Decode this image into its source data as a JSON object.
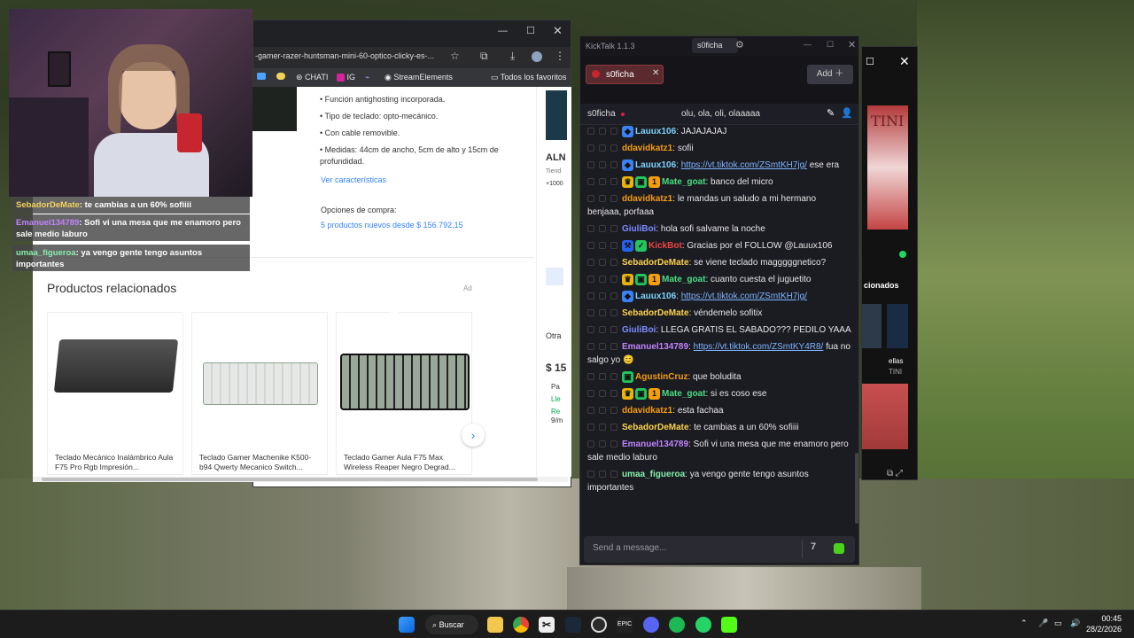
{
  "browser": {
    "url": "-gamer-razer-huntsman-mini-60-optico-clicky-es-...",
    "bookmarks": [
      "CHATI",
      "IG",
      "StreamElements",
      "Todos los favoritos"
    ],
    "features": [
      "Función antighosting incorporada.",
      "Tipo de teclado: opto-mecánico.",
      "Con cable removible.",
      "Medidas: 44cm de ancho, 5cm de alto y 15cm de profundidad."
    ],
    "ver_caracteristicas": "Ver características",
    "opciones_label": "Opciones de compra:",
    "opciones_link": "5 productos nuevos desde $ 156.792,15",
    "related_title": "Productos relacionados",
    "ad_label": "Ad",
    "products": [
      {
        "name": "Teclado Mecánico Inalámbrico Aula F75 Pro Rgb Impresión..."
      },
      {
        "name": "Teclado Gamer Machenike K500-b94 Qwerty Mecanico Switch..."
      },
      {
        "name": "Teclado Gamer Aula F75 Max Wireless Reaper Negro Degrad..."
      }
    ],
    "side_texts": [
      "ALN",
      "Tiend",
      "+1000",
      "Otra",
      "$ 15",
      "Pa",
      "Lle",
      "Re",
      "9/m"
    ]
  },
  "overlay": [
    {
      "user": "SebadorDeMate",
      "text": "te cambias a un 60% sofiiii",
      "color": "#f4d35e"
    },
    {
      "user": "Emanuel134789",
      "text": "Sofi vi una mesa que me enamoro pero sale medio laburo",
      "color": "#c084fc"
    },
    {
      "user": "umaa_figueroa",
      "text": "ya vengo gente tengo asuntos importantes",
      "color": "#86efac"
    }
  ],
  "kicktalk": {
    "app_title": "KickTalk 1.1.3",
    "channel_tab_title": "s0ficha",
    "tab_name": "s0ficha",
    "add_label": "Add",
    "header_channel": "s0ficha",
    "header_message": "olu, ola, oli, olaaaaa",
    "input_placeholder": "Send a message...",
    "messages": [
      {
        "user": "Lauux106",
        "color": "#7dd3fc",
        "badges": [
          "sub"
        ],
        "text": "JAJAJAJAJ",
        "link": ""
      },
      {
        "user": "ddavidkatz1",
        "color": "#f59e0b",
        "badges": [],
        "text": "sofii",
        "link": ""
      },
      {
        "user": "Lauux106",
        "color": "#7dd3fc",
        "badges": [
          "sub"
        ],
        "text": " ese era",
        "link": "https://vt.tiktok.com/ZSmtKH7jg/"
      },
      {
        "user": "Mate_goat",
        "color": "#4ade80",
        "badges": [
          "crown",
          "og",
          "one"
        ],
        "text": "banco del micro",
        "link": ""
      },
      {
        "user": "ddavidkatz1",
        "color": "#f59e0b",
        "badges": [],
        "text": "le mandas un saludo a mi hermano benjaaa, porfaaa",
        "link": ""
      },
      {
        "user": "GiuliBoi",
        "color": "#7c8cff",
        "badges": [],
        "text": "hola sofi salvame la noche",
        "link": ""
      },
      {
        "user": "KickBot",
        "color": "#ef4444",
        "badges": [
          "bot",
          "verified"
        ],
        "text": "Gracias por el FOLLOW @Lauux106",
        "link": ""
      },
      {
        "user": "SebadorDeMate",
        "color": "#fcd34d",
        "badges": [],
        "text": "se viene teclado magggggnetico?",
        "link": ""
      },
      {
        "user": "Mate_goat",
        "color": "#4ade80",
        "badges": [
          "crown",
          "og",
          "one"
        ],
        "text": "cuanto cuesta el juguetito",
        "link": ""
      },
      {
        "user": "Lauux106",
        "color": "#7dd3fc",
        "badges": [
          "sub"
        ],
        "text": "",
        "link": "https://vt.tiktok.com/ZSmtKH7jg/"
      },
      {
        "user": "SebadorDeMate",
        "color": "#fcd34d",
        "badges": [],
        "text": "véndemelo sofitix",
        "link": ""
      },
      {
        "user": "GiuliBoi",
        "color": "#7c8cff",
        "badges": [],
        "text": "LLEGA GRATIS EL SABADO??? PEDILO YAAA",
        "link": ""
      },
      {
        "user": "Emanuel134789",
        "color": "#c084fc",
        "badges": [],
        "text": " fua no salgo yo 😊",
        "link": "https://vt.tiktok.com/ZSmtKY4R8/"
      },
      {
        "user": "AgustinCruz",
        "color": "#f59e0b",
        "badges": [
          "og"
        ],
        "text": "que boludita",
        "link": ""
      },
      {
        "user": "Mate_goat",
        "color": "#4ade80",
        "badges": [
          "crown",
          "og",
          "one"
        ],
        "text": "si es coso ese",
        "link": ""
      },
      {
        "user": "ddavidkatz1",
        "color": "#f59e0b",
        "badges": [],
        "text": "esta fachaa",
        "link": ""
      },
      {
        "user": "SebadorDeMate",
        "color": "#fcd34d",
        "badges": [],
        "text": "te cambias a un 60% sofiiii",
        "link": ""
      },
      {
        "user": "Emanuel134789",
        "color": "#c084fc",
        "badges": [],
        "text": "Sofi vi una mesa que me enamoro pero sale medio laburo",
        "link": ""
      },
      {
        "user": "umaa_figueroa",
        "color": "#86efac",
        "badges": [],
        "text": "ya vengo gente tengo asuntos importantes",
        "link": ""
      }
    ]
  },
  "right_window": {
    "title_fragment": "TINI",
    "section": "cionados",
    "item_title": "ellas",
    "item_sub": "TINI"
  },
  "taskbar": {
    "search_label": "Buscar",
    "time": "00:45",
    "date": "28/2/2026"
  }
}
